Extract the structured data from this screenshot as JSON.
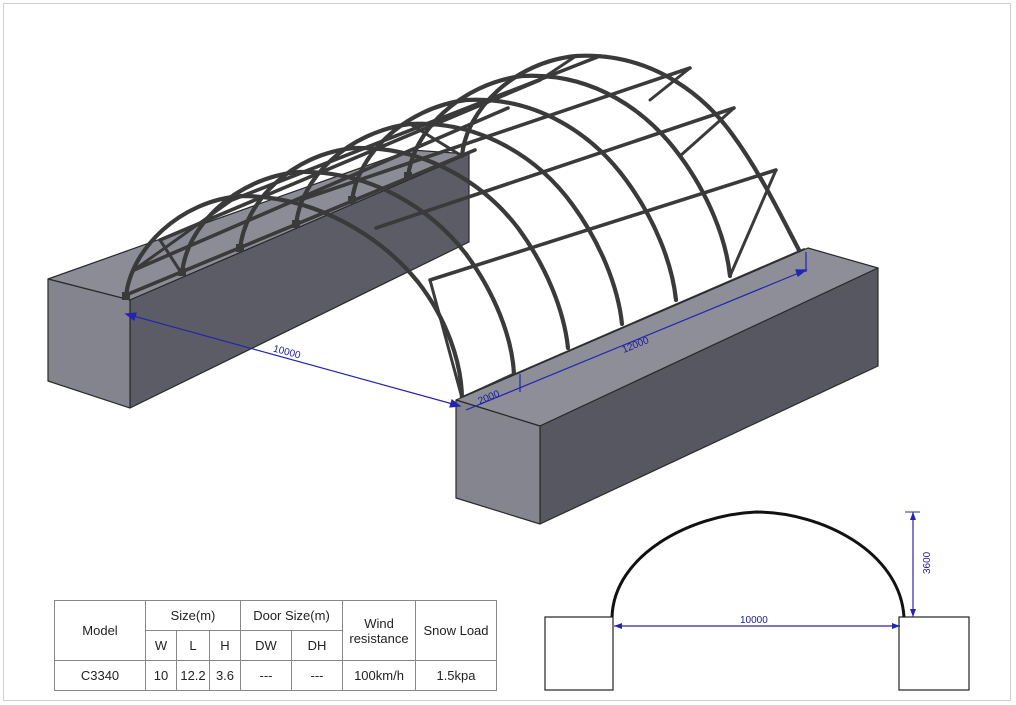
{
  "diagram": {
    "dimensions_iso": {
      "span_width": "10000",
      "length": "12000",
      "bay": "2000"
    },
    "dimensions_section": {
      "width": "10000",
      "height": "3600"
    }
  },
  "spec_table": {
    "headers": {
      "model": "Model",
      "size": "Size(m)",
      "door_size": "Door Size(m)",
      "wind": "Wind resistance",
      "snow": "Snow Load"
    },
    "subheaders": {
      "w": "W",
      "l": "L",
      "h": "H",
      "dw": "DW",
      "dh": "DH"
    },
    "row": {
      "model": "C3340",
      "w": "10",
      "l": "12.2",
      "h": "3.6",
      "dw": "---",
      "dh": "---",
      "wind": "100km/h",
      "snow": "1.5kpa"
    }
  }
}
